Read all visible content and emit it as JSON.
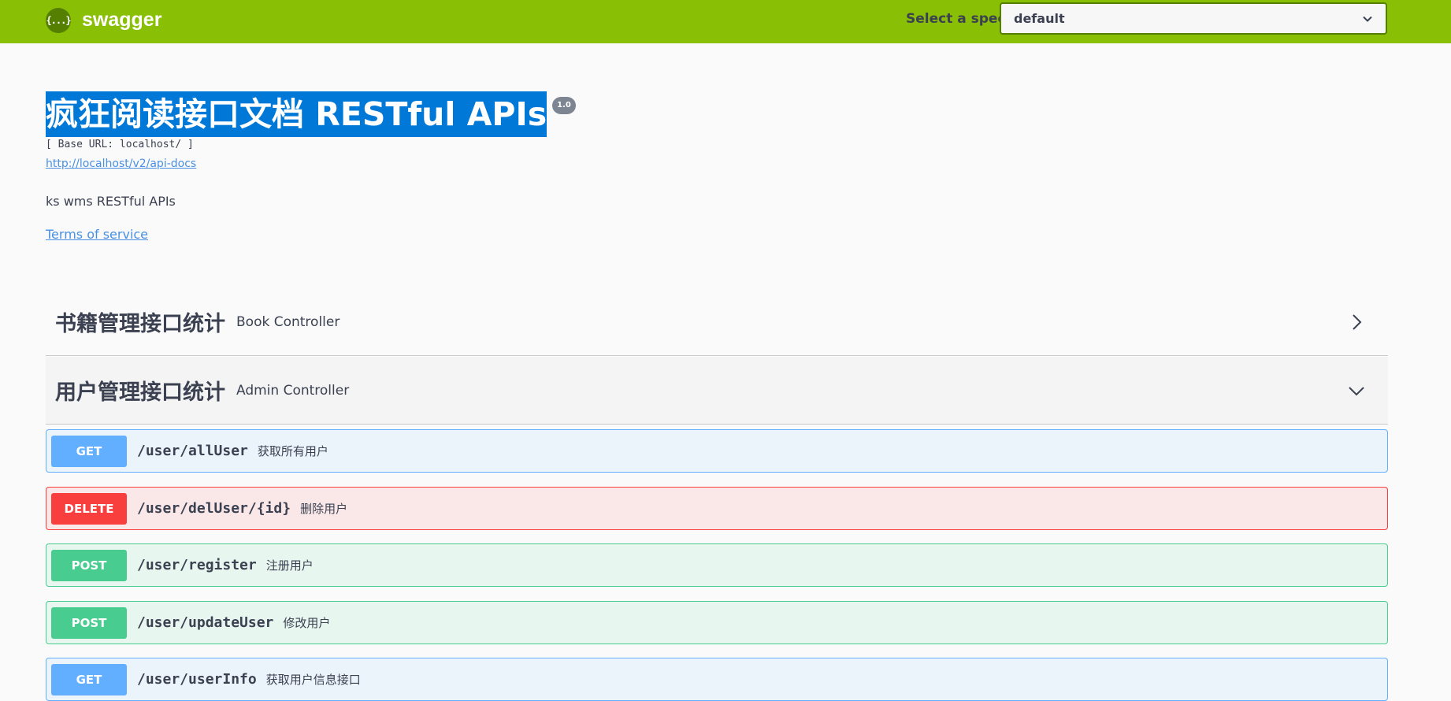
{
  "topbar": {
    "logo_icon": "{...}",
    "logo_text": "swagger",
    "spec_label": "Select a spec",
    "spec_selected": "default"
  },
  "info": {
    "title": "疯狂阅读接口文档 RESTful APIs",
    "version": "1.0",
    "base_url": "[ Base URL: localhost/ ]",
    "docs_link": "http://localhost/v2/api-docs",
    "description": "ks wms RESTful APIs",
    "terms": "Terms of service"
  },
  "tags": [
    {
      "name": "书籍管理接口统计",
      "description": "Book Controller",
      "expanded": false,
      "toggle_icon": "chevron-right-icon"
    },
    {
      "name": "用户管理接口统计",
      "description": "Admin Controller",
      "expanded": true,
      "toggle_icon": "chevron-down-icon"
    }
  ],
  "operations": [
    {
      "method": "GET",
      "path": "/user/allUser",
      "summary": "获取所有用户"
    },
    {
      "method": "DELETE",
      "path": "/user/delUser/{id}",
      "summary": "删除用户"
    },
    {
      "method": "POST",
      "path": "/user/register",
      "summary": "注册用户"
    },
    {
      "method": "POST",
      "path": "/user/updateUser",
      "summary": "修改用户"
    },
    {
      "method": "GET",
      "path": "/user/userInfo",
      "summary": "获取用户信息接口"
    }
  ],
  "colors": {
    "topbar": "#89bf04",
    "get": "#61affe",
    "delete": "#f93e3e",
    "post": "#49cc90",
    "selection": "#0078d7"
  }
}
